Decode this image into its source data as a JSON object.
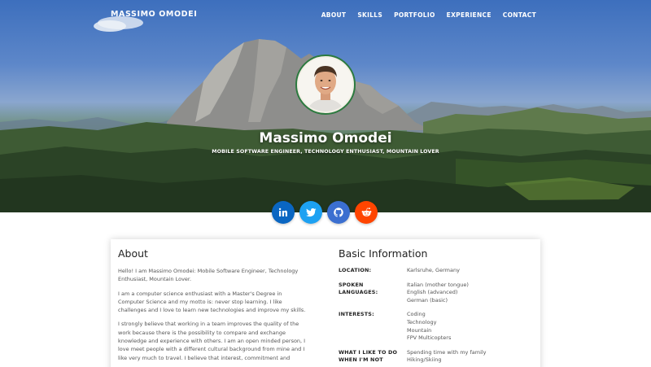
{
  "brand": "MASSIMO OMODEI",
  "nav": [
    "ABOUT",
    "SKILLS",
    "PORTFOLIO",
    "EXPERIENCE",
    "CONTACT"
  ],
  "hero": {
    "name": "Massimo Omodei",
    "tagline": "MOBILE SOFTWARE ENGINEER, TECHNOLOGY ENTHUSIAST, MOUNTAIN LOVER"
  },
  "socials": [
    {
      "name": "linkedin",
      "color": "#0a66c2",
      "icon": "linkedin-icon"
    },
    {
      "name": "twitter",
      "color": "#1da1f2",
      "icon": "twitter-icon"
    },
    {
      "name": "github",
      "color": "#3b6fd0",
      "icon": "github-icon"
    },
    {
      "name": "reddit",
      "color": "#ff4500",
      "icon": "reddit-icon"
    }
  ],
  "about": {
    "title": "About",
    "paragraphs": [
      [
        "Hello! I am Massimo Omodei: Mobile Software Engineer, Technology",
        "Enthusiast, Mountain Lover."
      ],
      [
        "I am a computer science enthusiast with a Master's Degree in",
        "Computer Science and my motto is: never stop learning. I like",
        "challenges and I love to learn new technologies and improve my skills."
      ],
      [
        "I strongly believe that working in a team improves the quality of the",
        "work because there is the possibility to compare and exchange",
        "knowledge and experience with others. I am an open minded person, I",
        "love meet people with a different cultural background from mine and I",
        "like very much to travel. I believe that interest, commitment and"
      ]
    ]
  },
  "basic_info": {
    "title": "Basic Information",
    "rows": [
      {
        "key": [
          "LOCATION:"
        ],
        "values": [
          "Karlsruhe, Germany"
        ]
      },
      {
        "key": [
          "SPOKEN",
          "LANGUAGES:"
        ],
        "values": [
          "Italian (mother tongue)",
          "English (advanced)",
          "German (basic)"
        ]
      },
      {
        "key": [
          "INTERESTS:"
        ],
        "values": [
          "Coding",
          "Technology",
          "Mountain",
          "FPV Multicopters"
        ]
      },
      {
        "key": [
          "WHAT I LIKE TO DO",
          "WHEN I'M NOT"
        ],
        "values": [
          "Spending time with my family",
          "Hiking/Skiing"
        ]
      }
    ]
  },
  "colors": {
    "avatar_border": "#2c7a3f",
    "heading": "#222222",
    "text": "#555555"
  }
}
